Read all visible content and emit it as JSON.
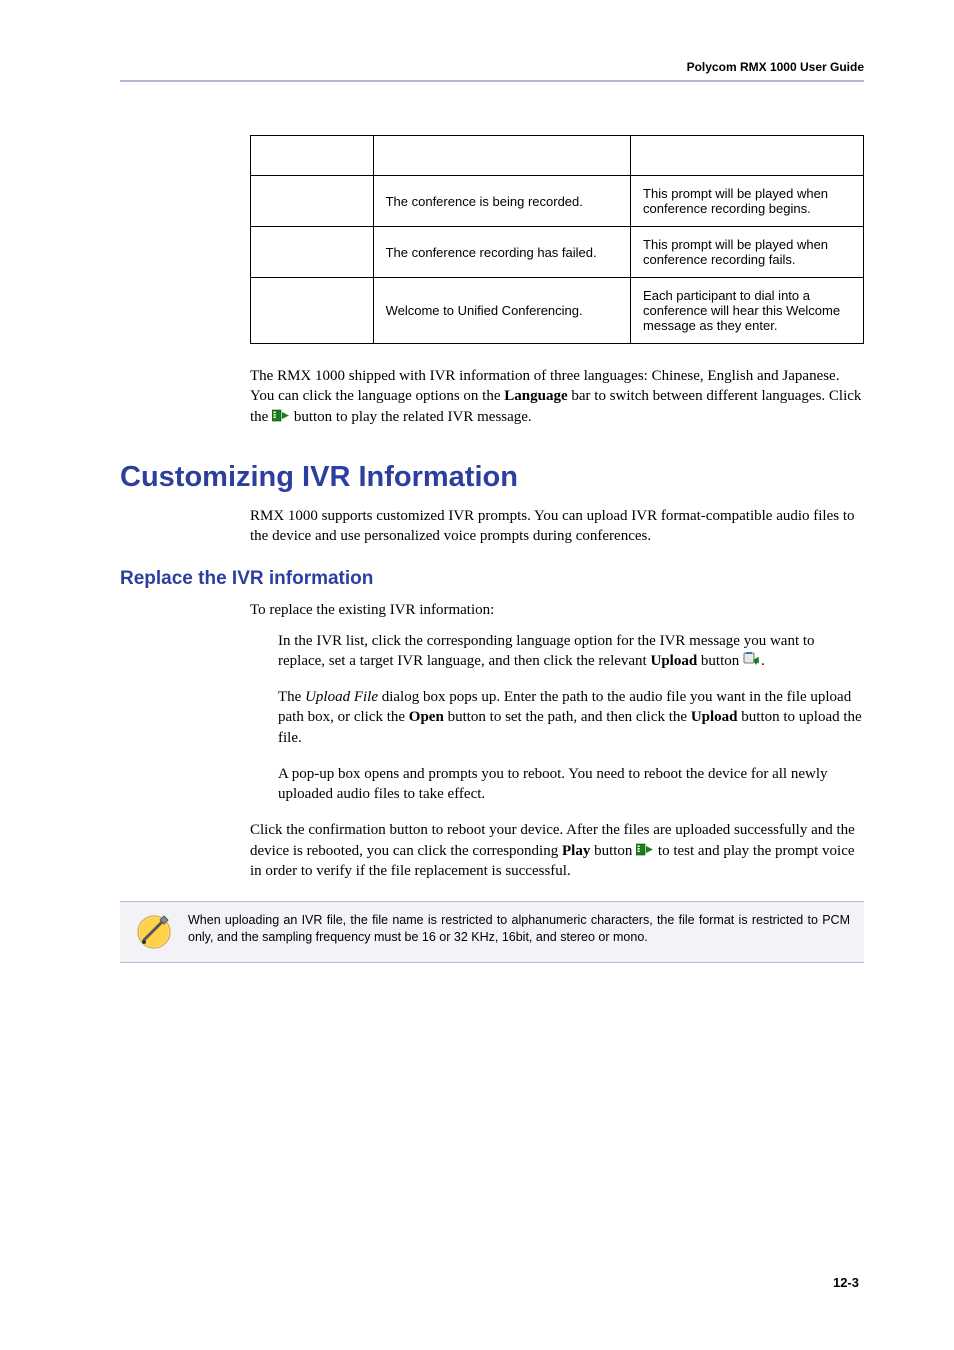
{
  "header": {
    "title": "Polycom RMX 1000 User Guide"
  },
  "table": {
    "headers": {
      "param": "",
      "voice": "",
      "desc": ""
    },
    "rows": [
      {
        "param": "",
        "voice": "The conference is being recorded.",
        "desc": "This prompt will be played when conference recording begins."
      },
      {
        "param": "",
        "voice": "The conference recording has failed.",
        "desc": "This prompt will be played when conference recording fails."
      },
      {
        "param": "",
        "voice": "Welcome to Unified Conferencing.",
        "desc": "Each participant to dial into a conference will hear this Welcome message as they enter."
      }
    ]
  },
  "para1_pre": "The RMX 1000 shipped with IVR information of three languages: Chinese, English and Japanese. You can click the language options on the ",
  "para1_bold": "Language",
  "para1_mid": " bar to switch between different languages. Click the ",
  "para1_post": " button to play the related IVR message.",
  "h1": "Customizing IVR Information",
  "para2": "RMX 1000 supports customized IVR prompts. You can upload IVR format-compatible audio files to the device and use personalized voice prompts during conferences.",
  "h2": "Replace the IVR information",
  "para3": "To replace the existing IVR information:",
  "steps": [
    {
      "pre": "In the IVR list, click the corresponding language option for the IVR message you want to replace, set a target IVR language, and then click the relevant ",
      "b1": "Upload",
      "mid": " button ",
      "icon": "upload",
      "post": "."
    },
    {
      "pre": "The ",
      "i1": "Upload File",
      "mid": " dialog box pops up. Enter the path to the audio file you want in the file upload path box, or click the ",
      "b1": "Open",
      "mid2": " button to set the path, and then click the ",
      "b2": "Upload",
      "post": " button to upload the file."
    },
    {
      "pre": "A pop-up box opens and prompts you to reboot. You need to reboot the device for all newly uploaded audio files to take effect."
    }
  ],
  "para4_pre": "Click the confirmation button to reboot your device. After the files are uploaded successfully and the device is rebooted, you can click the corresponding ",
  "para4_b": "Play",
  "para4_mid": " button ",
  "para4_post": " to test and play the prompt voice in order to verify if the file replacement is successful.",
  "note": "When uploading an IVR file, the file name is restricted to alphanumeric characters, the file format is restricted to PCM only, and the sampling frequency must be 16 or 32 KHz, 16bit, and stereo or mono.",
  "page_num": "12-3"
}
